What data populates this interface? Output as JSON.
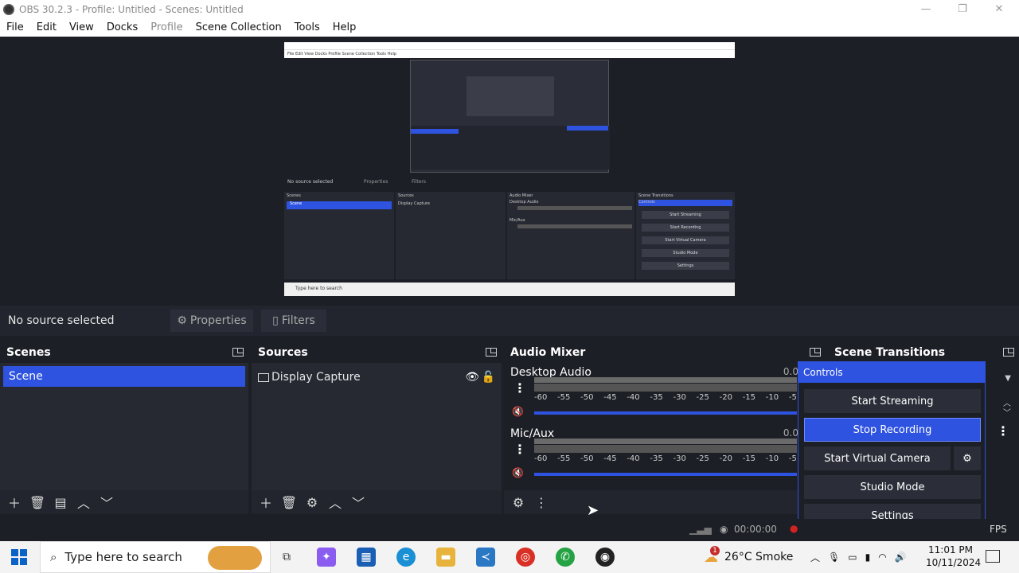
{
  "window": {
    "title": "OBS 30.2.3 - Profile: Untitled - Scenes: Untitled",
    "minimize": "—",
    "maximize": "❐",
    "close": "✕"
  },
  "menu": [
    "File",
    "Edit",
    "View",
    "Docks",
    "Profile",
    "Scene Collection",
    "Tools",
    "Help"
  ],
  "source_bar": {
    "no_source": "No source selected",
    "properties": "Properties",
    "filters": "Filters"
  },
  "scenes": {
    "title": "Scenes",
    "items": [
      "Scene"
    ]
  },
  "sources": {
    "title": "Sources",
    "items": [
      "Display Capture"
    ]
  },
  "audio_mixer": {
    "title": "Audio Mixer",
    "channels": [
      {
        "name": "Desktop Audio",
        "db": "0.0"
      },
      {
        "name": "Mic/Aux",
        "db": "0.0"
      }
    ],
    "ticks": [
      "-60",
      "-55",
      "-50",
      "-45",
      "-40",
      "-35",
      "-30",
      "-25",
      "-20",
      "-15",
      "-10",
      "-5"
    ]
  },
  "scene_transitions": {
    "title": "Scene Transitions"
  },
  "controls": {
    "title": "Controls",
    "start_streaming": "Start Streaming",
    "stop_recording": "Stop Recording",
    "start_virtual_camera": "Start Virtual Camera",
    "studio_mode": "Studio Mode",
    "settings": "Settings"
  },
  "status": {
    "time": "00:00:00",
    "fps": "FPS"
  },
  "taskbar": {
    "search_placeholder": "Type here to search",
    "weather": "26°C  Smoke",
    "weather_badge": "1",
    "time": "11:01 PM",
    "date": "10/11/2024"
  },
  "preview_mini": {
    "menu": "File  Edit  View  Docks  Profile  Scene Collection  Tools  Help",
    "no_source": "No source selected",
    "properties": "Properties",
    "filters": "Filters",
    "scenes": "Scenes",
    "sources": "Sources",
    "audio_mixer": "Audio Mixer",
    "scene_transitions": "Scene Transitions",
    "scene_item": "Scene",
    "source_item": "Display Capture",
    "desktop_audio": "Desktop Audio",
    "mic_aux": "Mic/Aux",
    "controls": "Controls",
    "start_streaming": "Start Streaming",
    "start_recording": "Start Recording",
    "start_virtual_camera": "Start Virtual Camera",
    "studio_mode": "Studio Mode",
    "settings": "Settings",
    "search": "Type here to search"
  },
  "colors": {
    "accent": "#2e53e0",
    "panel": "#262932",
    "background": "#1d1f26"
  }
}
